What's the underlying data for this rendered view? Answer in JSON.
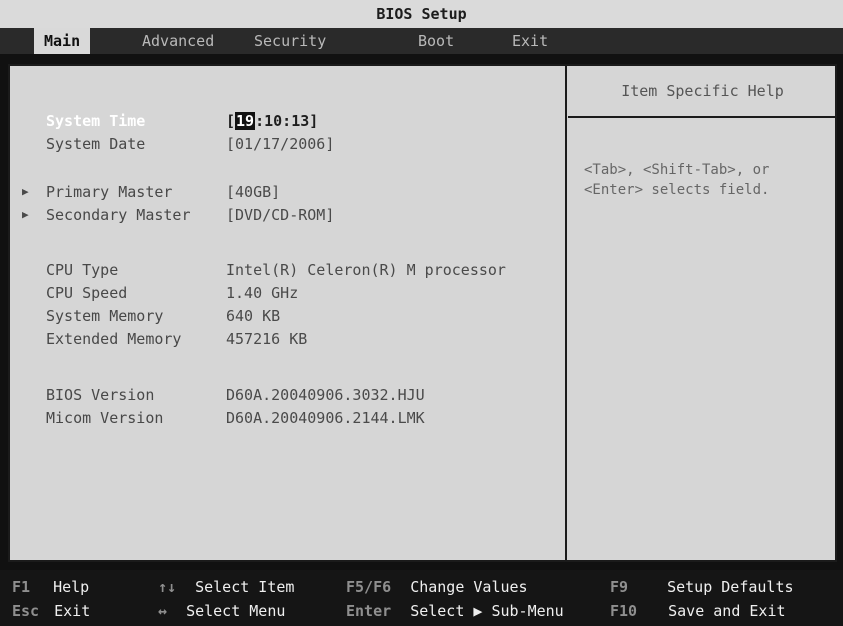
{
  "title": "BIOS Setup",
  "tabs": [
    {
      "label": "Main"
    },
    {
      "label": "Advanced"
    },
    {
      "label": "Security"
    },
    {
      "label": "Boot"
    },
    {
      "label": "Exit"
    }
  ],
  "main": {
    "items": [
      {
        "label": "System Time",
        "value_prefix": "[",
        "value_selected": "19",
        "value_rest": ":10:13]"
      },
      {
        "label": "System Date",
        "value": "[01/17/2006]"
      },
      {
        "label": "Primary Master",
        "value": "[40GB]"
      },
      {
        "label": "Secondary Master",
        "value": "[DVD/CD-ROM]"
      },
      {
        "label": "CPU Type",
        "value": "Intel(R) Celeron(R) M processor"
      },
      {
        "label": "CPU Speed",
        "value": "1.40 GHz"
      },
      {
        "label": "System Memory",
        "value": "640 KB"
      },
      {
        "label": "Extended Memory",
        "value": "457216 KB"
      },
      {
        "label": "BIOS Version",
        "value": "D60A.20040906.3032.HJU"
      },
      {
        "label": "Micom Version",
        "value": "D60A.20040906.2144.LMK"
      }
    ]
  },
  "help": {
    "title": "Item Specific Help",
    "text": "<Tab>, <Shift-Tab>, or <Enter> selects field."
  },
  "footer": {
    "row1": [
      {
        "key": "F1",
        "text": "Help"
      },
      {
        "key": "↑↓",
        "text": "Select Item"
      },
      {
        "key": "F5/F6",
        "text": "Change Values"
      },
      {
        "key": "F9",
        "text": "Setup Defaults"
      }
    ],
    "row2": [
      {
        "key": "Esc",
        "text": "Exit"
      },
      {
        "key": "↔",
        "text": "Select Menu"
      },
      {
        "key": "Enter",
        "text": "Select ▶ Sub-Menu"
      },
      {
        "key": "F10",
        "text": "Save and Exit"
      }
    ]
  }
}
